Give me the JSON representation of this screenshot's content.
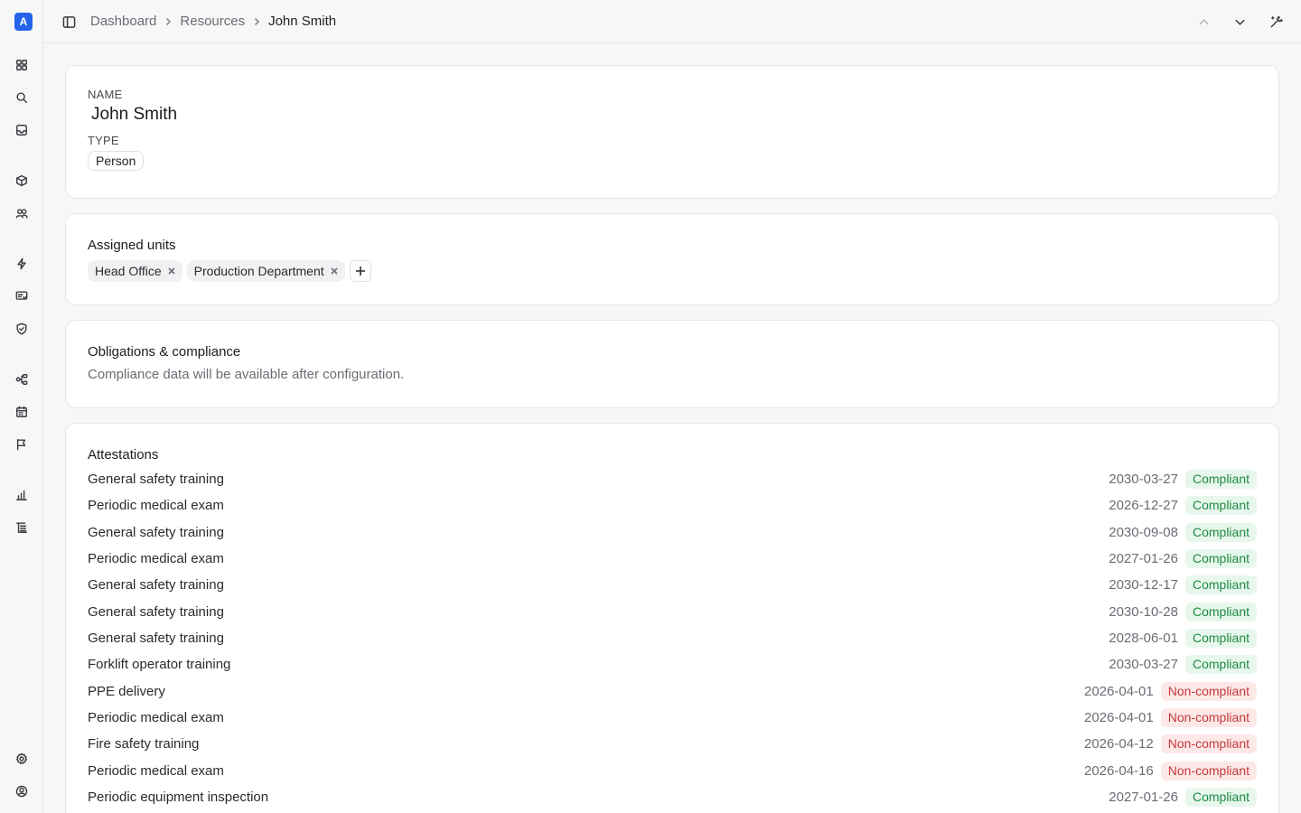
{
  "app": {
    "logo_letter": "A"
  },
  "sidebar": {
    "icons": [
      "grid-icon",
      "search-icon",
      "inbox-icon",
      "cube-icon",
      "users-icon",
      "bolt-icon",
      "monitor-check-icon",
      "shield-check-icon",
      "workflow-icon",
      "calendar-icon",
      "flag-icon",
      "bar-chart-icon",
      "list-icon",
      "settings-icon",
      "user-circle-icon"
    ]
  },
  "breadcrumb": {
    "items": [
      "Dashboard",
      "Resources"
    ],
    "current": "John Smith"
  },
  "resource": {
    "name_label": "NAME",
    "name": "John Smith",
    "type_label": "TYPE",
    "type": "Person"
  },
  "units": {
    "title": "Assigned units",
    "items": [
      "Head Office",
      "Production Department"
    ]
  },
  "compliance": {
    "title": "Obligations & compliance",
    "message": "Compliance data will be available after configuration."
  },
  "attestations": {
    "title": "Attestations",
    "rows": [
      {
        "name": "General safety training",
        "date": "2030-03-27",
        "status": "Compliant"
      },
      {
        "name": "Periodic medical exam",
        "date": "2026-12-27",
        "status": "Compliant"
      },
      {
        "name": "General safety training",
        "date": "2030-09-08",
        "status": "Compliant"
      },
      {
        "name": "Periodic medical exam",
        "date": "2027-01-26",
        "status": "Compliant"
      },
      {
        "name": "General safety training",
        "date": "2030-12-17",
        "status": "Compliant"
      },
      {
        "name": "General safety training",
        "date": "2030-10-28",
        "status": "Compliant"
      },
      {
        "name": "General safety training",
        "date": "2028-06-01",
        "status": "Compliant"
      },
      {
        "name": "Forklift operator training",
        "date": "2030-03-27",
        "status": "Compliant"
      },
      {
        "name": "PPE delivery",
        "date": "2026-04-01",
        "status": "Non-compliant"
      },
      {
        "name": "Periodic medical exam",
        "date": "2026-04-01",
        "status": "Non-compliant"
      },
      {
        "name": "Fire safety training",
        "date": "2026-04-12",
        "status": "Non-compliant"
      },
      {
        "name": "Periodic medical exam",
        "date": "2026-04-16",
        "status": "Non-compliant"
      },
      {
        "name": "Periodic equipment inspection",
        "date": "2027-01-26",
        "status": "Compliant"
      }
    ]
  },
  "colors": {
    "accent": "#2563eb",
    "compliant_bg": "#e7f7ec",
    "compliant_fg": "#1e8a44",
    "noncompliant_bg": "#fde8e8",
    "noncompliant_fg": "#c43a3a"
  }
}
